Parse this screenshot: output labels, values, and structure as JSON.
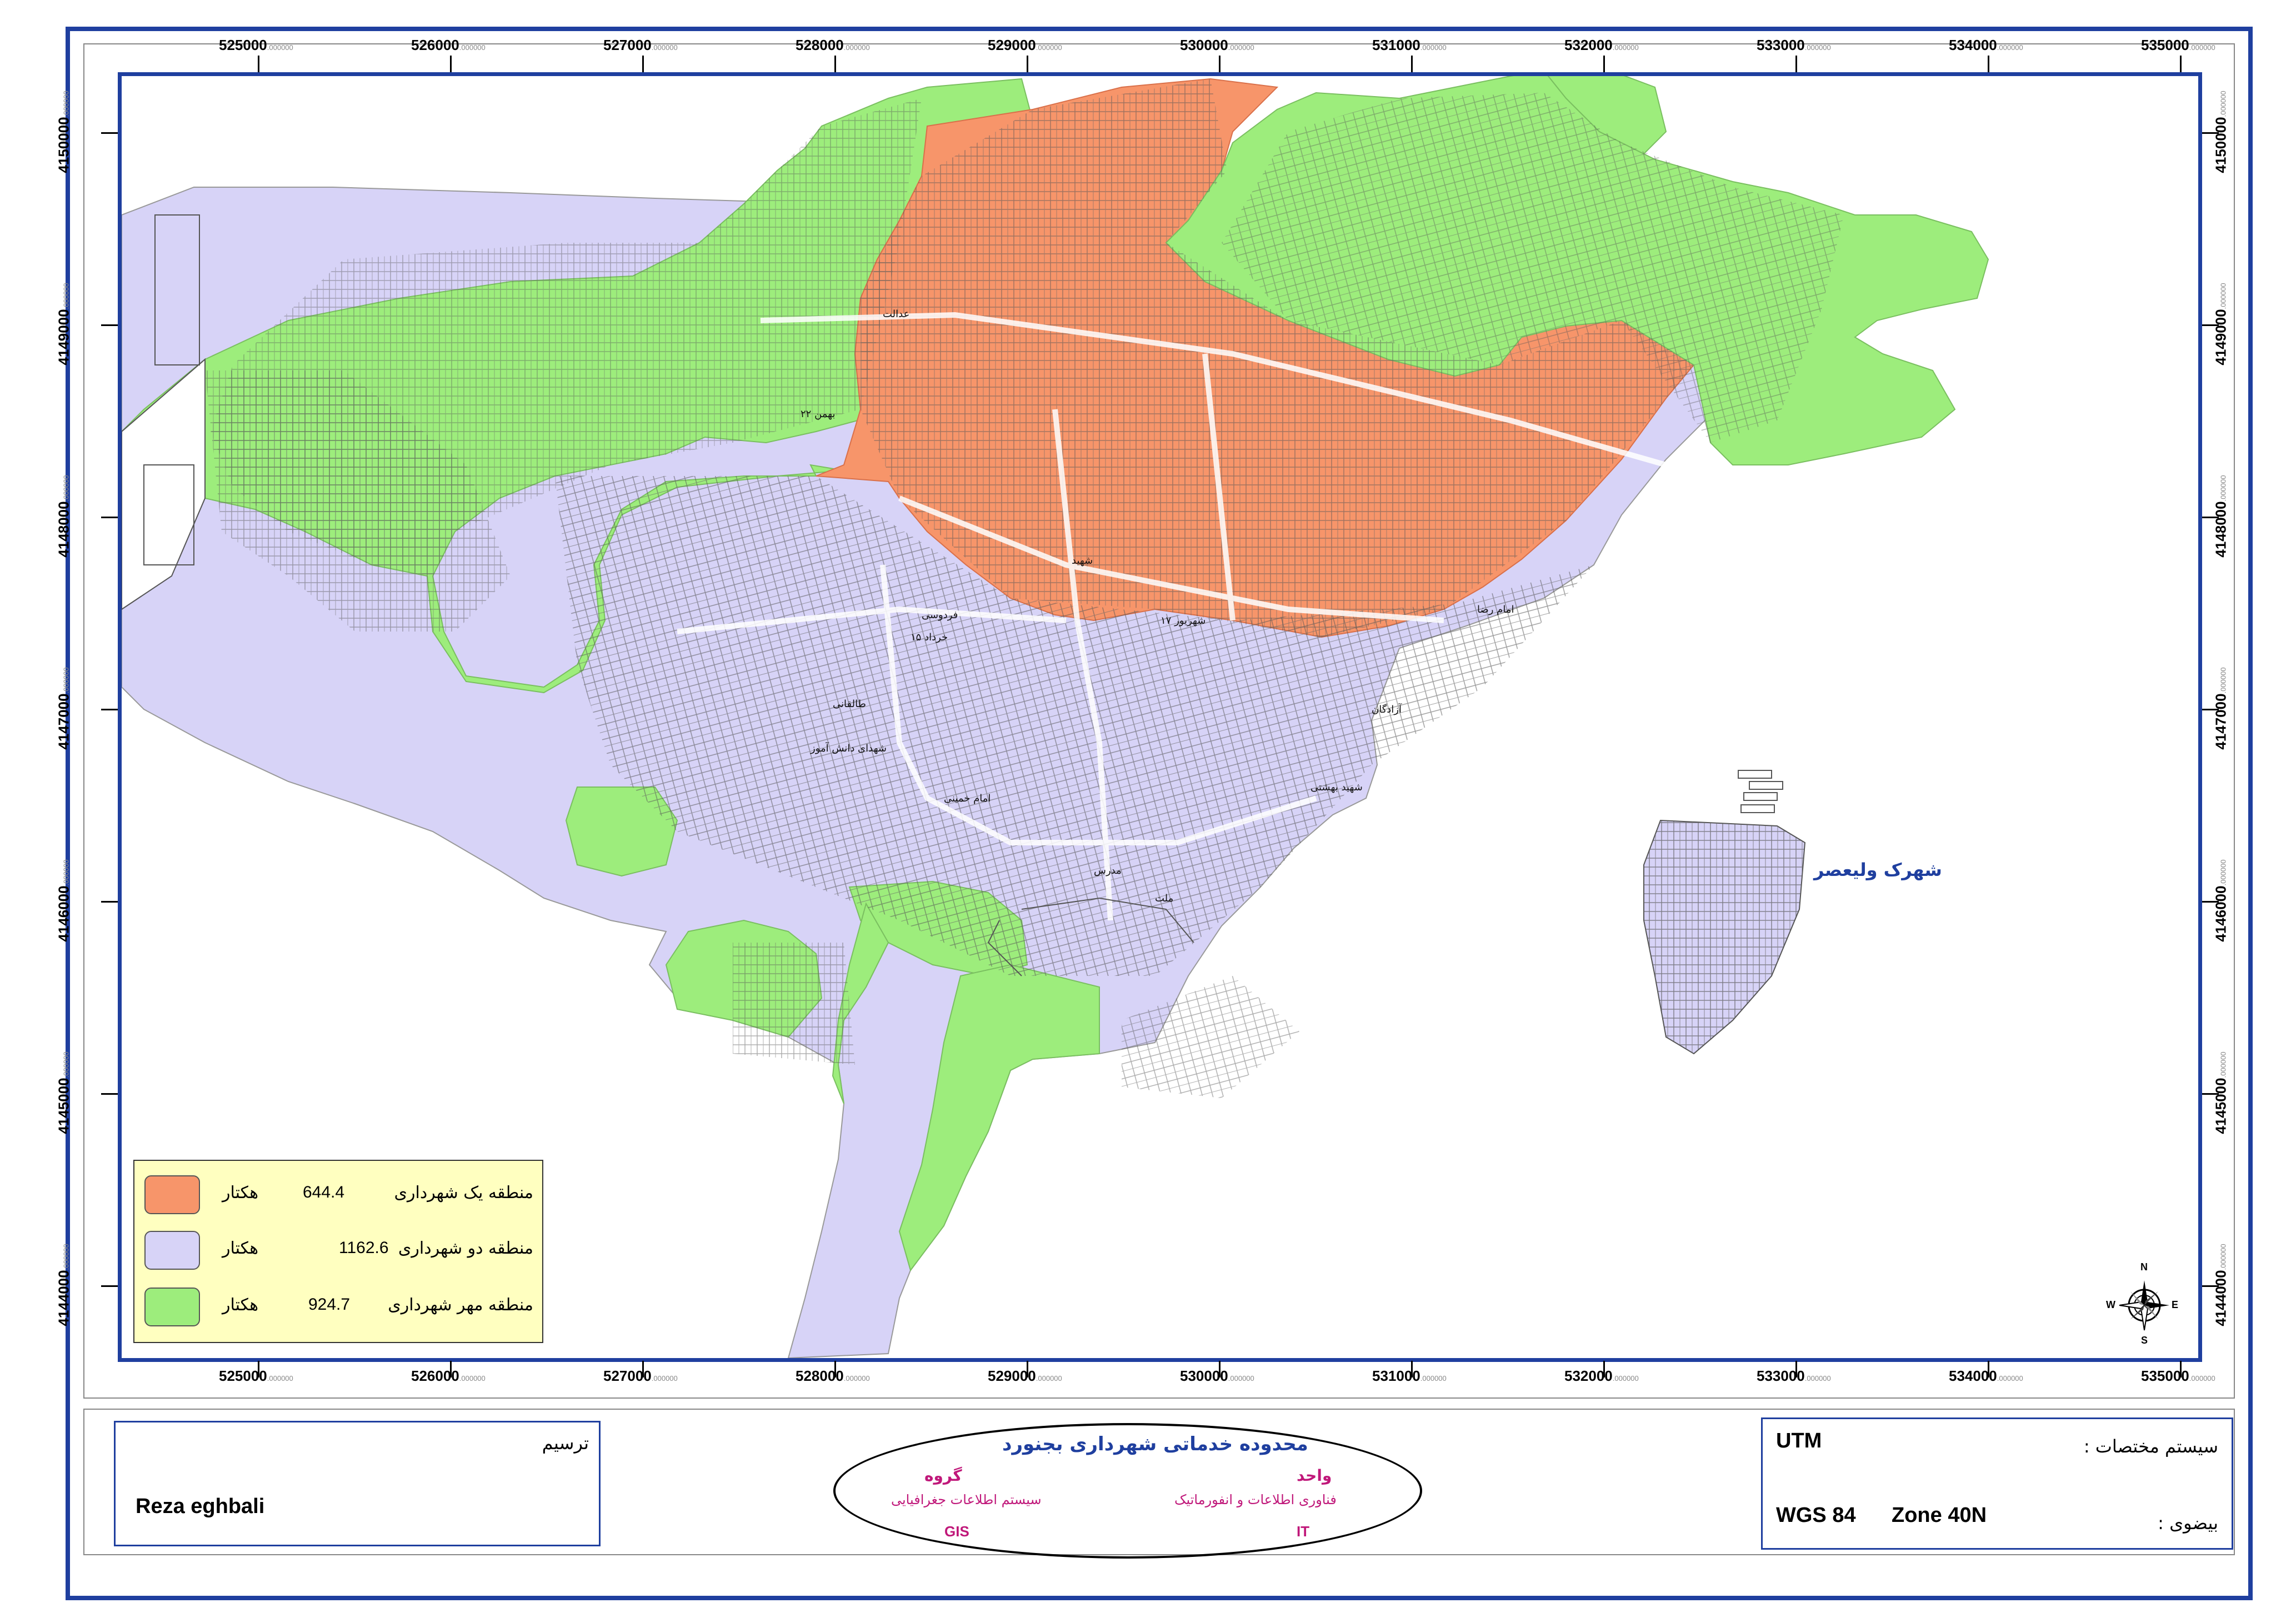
{
  "x_ticks": [
    {
      "value": "525000",
      "suffix": ".000000"
    },
    {
      "value": "526000",
      "suffix": ".000000"
    },
    {
      "value": "527000",
      "suffix": ".000000"
    },
    {
      "value": "528000",
      "suffix": ".000000"
    },
    {
      "value": "529000",
      "suffix": ".000000"
    },
    {
      "value": "530000",
      "suffix": ".000000"
    },
    {
      "value": "531000",
      "suffix": ".000000"
    },
    {
      "value": "532000",
      "suffix": ".000000"
    },
    {
      "value": "533000",
      "suffix": ".000000"
    },
    {
      "value": "534000",
      "suffix": ".000000"
    },
    {
      "value": "535000",
      "suffix": ".000000"
    }
  ],
  "y_ticks": [
    {
      "value": "4150000",
      "suffix": ".000000"
    },
    {
      "value": "4149000",
      "suffix": ".000000"
    },
    {
      "value": "4148000",
      "suffix": ".000000"
    },
    {
      "value": "4147000",
      "suffix": ".000000"
    },
    {
      "value": "4146000",
      "suffix": ".000000"
    },
    {
      "value": "4145000",
      "suffix": ".000000"
    },
    {
      "value": "4144000",
      "suffix": ".000000"
    }
  ],
  "legend": {
    "items": [
      {
        "label": "منطقه یک شهرداری",
        "value": "644.4",
        "unit": "هکتار",
        "color": "#f7956a"
      },
      {
        "label": "منطقه دو شهرداری",
        "value": "1162.6",
        "unit": "هکتار",
        "color": "#d7d3f7"
      },
      {
        "label": "منطقه مهر شهرداری",
        "value": "924.7",
        "unit": "هکتار",
        "color": "#9ded7c"
      }
    ]
  },
  "place_label": "شهرک ولیعصر",
  "street_labels": [
    {
      "text": "۲۲ بهمن"
    },
    {
      "text": "عدالت"
    },
    {
      "text": "امام رضا"
    },
    {
      "text": "شهید"
    },
    {
      "text": "فردوسی"
    },
    {
      "text": "۱۵ خرداد"
    },
    {
      "text": "۱۷ شهریور"
    },
    {
      "text": "آزادگان"
    },
    {
      "text": "شهدای دانش آموز"
    },
    {
      "text": "طالقانی"
    },
    {
      "text": "مدرس"
    },
    {
      "text": "امام خمینی"
    },
    {
      "text": "ملت"
    },
    {
      "text": "شهید بهشتی"
    }
  ],
  "compass": {
    "n": "N",
    "s": "S",
    "e": "E",
    "w": "W"
  },
  "bottom": {
    "drawn_by_label": "ترسیم",
    "drawn_by_name": "Reza eghbali",
    "center_title": "محدوده خدماتی شهرداری بجنورد",
    "group_label": "گروه",
    "group_value": "سیستم اطلاعات جغرافیایی",
    "group_abbr": "GIS",
    "unit_label": "واحد",
    "unit_value": "فناوری اطلاعات و انفورماتیک",
    "unit_abbr": "IT",
    "coord_system_label": "سیستم مختصات :",
    "coord_system_value": "UTM",
    "ellipsoid_label": "بیضوی :",
    "ellipsoid_value": "WGS 84",
    "zone_value": "Zone 40N"
  },
  "colors": {
    "frame": "#1f3f9f",
    "zone1": "#f7956a",
    "zone2": "#d7d3f7",
    "zone3": "#9ded7c",
    "magenta": "#c0187a",
    "legend_bg": "#ffffc0"
  }
}
